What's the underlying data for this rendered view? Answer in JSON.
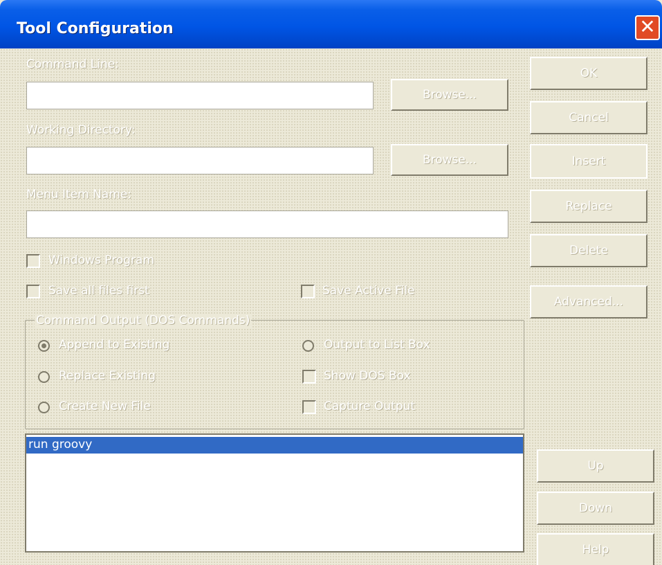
{
  "window": {
    "title": "Tool Configuration",
    "close_glyph": "✕"
  },
  "labels": {
    "command_line": "Command Line:",
    "working_directory": "Working Directory:",
    "menu_item_name": "Menu Item Name:"
  },
  "fields": {
    "command_line": "",
    "working_directory": "",
    "menu_item_name": ""
  },
  "buttons": {
    "browse_command": "Browse...",
    "browse_directory": "Browse...",
    "ok": "OK",
    "cancel": "Cancel",
    "insert": "Insert",
    "replace": "Replace",
    "delete": "Delete",
    "advanced": "Advanced...",
    "up": "Up",
    "down": "Down",
    "help": "Help"
  },
  "checkboxes": {
    "windows_program": "Windows Program",
    "save_all_files_first": "Save all files first",
    "save_active_file": "Save Active File"
  },
  "output_group": {
    "title": "Command Output (DOS Commands)",
    "append_to_existing": "Append to Existing",
    "output_to_list_box": "Output to List Box",
    "replace_existing": "Replace Existing",
    "show_dos_box": "Show DOS Box",
    "create_new_file": "Create New File",
    "capture_output": "Capture Output"
  },
  "tools_list": {
    "items": [
      "run groovy"
    ]
  },
  "colors": {
    "titlebar": "#0055E5",
    "close": "#E14A24",
    "selection": "#316AC5",
    "face": "#ECE9D8"
  },
  "icons": {
    "close": "close-icon"
  }
}
